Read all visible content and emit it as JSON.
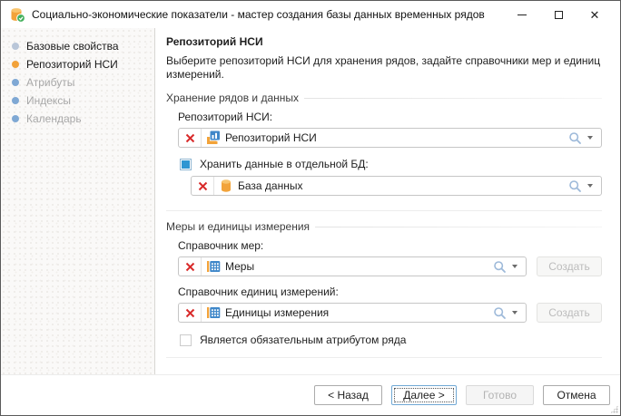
{
  "window": {
    "title": "Социально-экономические показатели - мастер создания базы данных временных рядов",
    "close_glyph": "✕"
  },
  "sidebar": {
    "items": [
      {
        "label": "Базовые свойства",
        "state": "done"
      },
      {
        "label": "Репозиторий НСИ",
        "state": "current"
      },
      {
        "label": "Атрибуты",
        "state": "pending"
      },
      {
        "label": "Индексы",
        "state": "pending"
      },
      {
        "label": "Календарь",
        "state": "pending"
      }
    ]
  },
  "content": {
    "heading": "Репозиторий НСИ",
    "description": "Выберите репозиторий НСИ для хранения рядов, задайте справочники мер и единиц измерений.",
    "storage": {
      "label": "Хранение рядов и данных",
      "repo_label": "Репозиторий НСИ:",
      "repo_value": "Репозиторий НСИ",
      "db_check_label": "Хранить данные в отдельной БД:",
      "db_checked": true,
      "db_value": "База данных"
    },
    "measures": {
      "label": "Меры и единицы измерения",
      "measures_label": "Справочник мер:",
      "measures_value": "Меры",
      "create_label": "Создать",
      "units_label": "Справочник единиц измерений:",
      "units_value": "Единицы измерения",
      "required_label": "Является обязательным атрибутом ряда",
      "required_checked": false
    }
  },
  "footer": {
    "back": "< Назад",
    "next": "Далее >",
    "finish": "Готово",
    "cancel": "Отмена"
  },
  "colors": {
    "accent_orange": "#f2a23a",
    "icon_blue": "#3f87c9",
    "checkbox_blue": "#2f96d2",
    "clear_red": "#d92b2b",
    "pending_step_blue": "#7fa8d4",
    "done_step_gray_blue": "#b9c6d8"
  }
}
